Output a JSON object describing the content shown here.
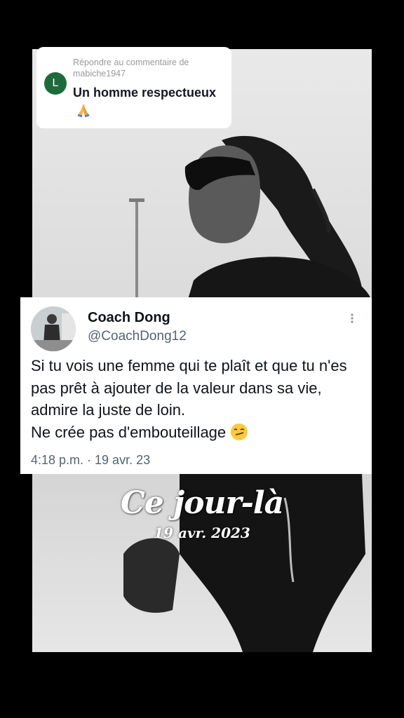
{
  "reply": {
    "label": "Répondre au commentaire de mabiche1947",
    "avatar_letter": "L",
    "avatar_color": "#1f6a3b",
    "text": "Un homme respectueux",
    "emoji_icon": "folded-hands-icon"
  },
  "tweet": {
    "name": "Coach Dong",
    "handle": "@CoachDong12",
    "body": "Si tu vois une femme qui te plaît et que tu n'es pas prêt à ajouter de la valeur dans sa vie, admire la juste de loin.\nNe crée pas d'embouteillage",
    "emoji_icon": "smirking-face-icon",
    "timestamp": "4:18 p.m. · 19 avr. 23"
  },
  "overlay": {
    "title": "Ce jour-là",
    "date": "19 avr. 2023"
  }
}
